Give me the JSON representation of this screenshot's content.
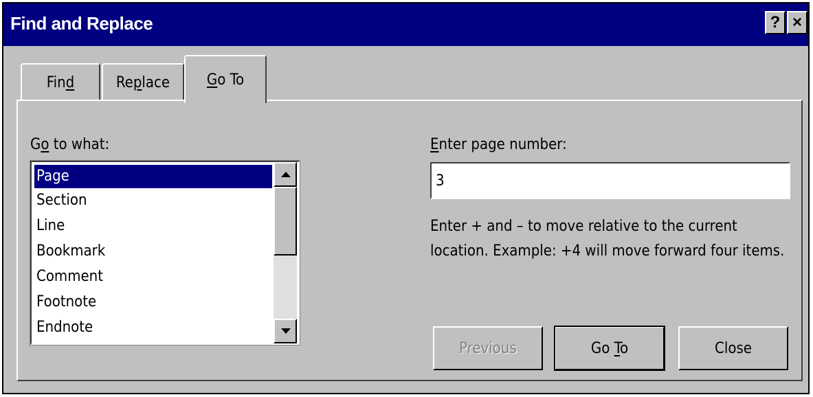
{
  "window": {
    "title": "Find and Replace",
    "help_label": "?",
    "close_label": "×"
  },
  "tabs": [
    {
      "pre": "Fin",
      "mnemonic": "d",
      "post": ""
    },
    {
      "pre": "Re",
      "mnemonic": "p",
      "post": "lace"
    },
    {
      "pre": "",
      "mnemonic": "G",
      "post": "o To"
    }
  ],
  "active_tab": "Go To",
  "goto_what": {
    "pre": "G",
    "mnemonic": "o",
    "post": " to what:",
    "items": [
      "Page",
      "Section",
      "Line",
      "Bookmark",
      "Comment",
      "Footnote",
      "Endnote"
    ],
    "selected": "Page"
  },
  "page_number": {
    "pre": "",
    "mnemonic": "E",
    "post": "nter page number:",
    "value": "3"
  },
  "help_text": "Enter + and – to move relative to the current location. Example: +4 will move forward four items.",
  "buttons": {
    "previous": "Previous",
    "goto_pre": "Go ",
    "goto_mnemonic": "T",
    "goto_post": "o",
    "close": "Close"
  },
  "colors": {
    "titlebar": "#000080",
    "face": "#c0c0c0",
    "selection": "#000080"
  }
}
